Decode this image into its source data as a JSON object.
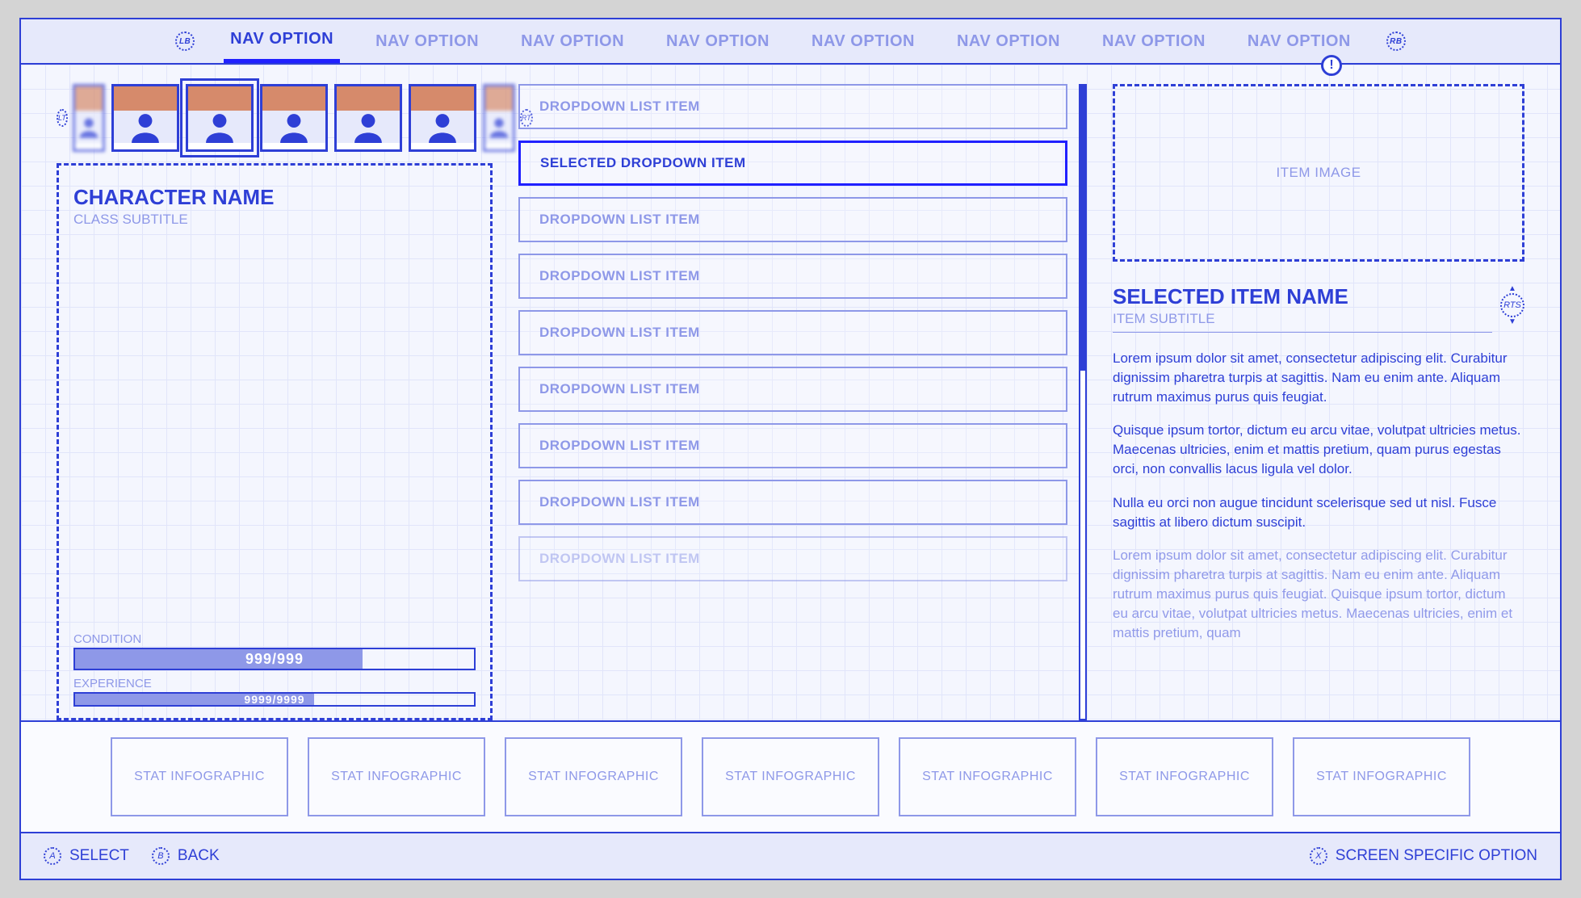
{
  "nav": {
    "bumper_left": "LB",
    "bumper_right": "RB",
    "items": [
      {
        "label": "NAV OPTION",
        "active": true
      },
      {
        "label": "NAV OPTION"
      },
      {
        "label": "NAV OPTION"
      },
      {
        "label": "NAV OPTION"
      },
      {
        "label": "NAV OPTION"
      },
      {
        "label": "NAV OPTION"
      },
      {
        "label": "NAV OPTION"
      },
      {
        "label": "NAV OPTION"
      }
    ],
    "alert_glyph": "!"
  },
  "roster": {
    "trigger_left": "LT",
    "trigger_right": "RT",
    "portraits": [
      {
        "selected": false,
        "blurred": true
      },
      {
        "selected": false
      },
      {
        "selected": true
      },
      {
        "selected": false
      },
      {
        "selected": false
      },
      {
        "selected": false
      },
      {
        "selected": false,
        "blurred": true
      }
    ]
  },
  "character": {
    "name": "CHARACTER NAME",
    "subtitle": "CLASS SUBTITLE",
    "condition": {
      "label": "CONDITION",
      "text": "999/999",
      "pct": 72
    },
    "experience": {
      "label": "EXPERIENCE",
      "text": "9999/9999",
      "pct": 60
    }
  },
  "list": {
    "items": [
      {
        "label": "DROPDOWN LIST ITEM"
      },
      {
        "label": "SELECTED DROPDOWN ITEM",
        "selected": true
      },
      {
        "label": "DROPDOWN LIST ITEM"
      },
      {
        "label": "DROPDOWN LIST ITEM"
      },
      {
        "label": "DROPDOWN LIST ITEM"
      },
      {
        "label": "DROPDOWN LIST ITEM"
      },
      {
        "label": "DROPDOWN LIST ITEM"
      },
      {
        "label": "DROPDOWN LIST ITEM"
      },
      {
        "label": "DROPDOWN LIST ITEM",
        "faded": true
      }
    ]
  },
  "detail": {
    "image_placeholder": "ITEM IMAGE",
    "title": "SELECTED ITEM NAME",
    "subtitle": "ITEM SUBTITLE",
    "rts": "RTS",
    "paragraphs": [
      "Lorem ipsum dolor sit amet, consectetur adipiscing elit. Curabitur dignissim pharetra turpis at sagittis. Nam eu enim ante. Aliquam rutrum maximus purus quis feugiat.",
      "Quisque ipsum tortor, dictum eu arcu vitae, volutpat ultricies metus. Maecenas ultricies, enim et mattis pretium, quam purus egestas orci, non convallis lacus ligula vel dolor.",
      "Nulla eu orci non augue tincidunt scelerisque sed ut nisl. Fusce sagittis at libero dictum suscipit.",
      "Lorem ipsum dolor sit amet, consectetur adipiscing elit. Curabitur dignissim pharetra turpis at sagittis. Nam eu enim ante. Aliquam rutrum maximus purus quis feugiat. Quisque ipsum tortor, dictum eu arcu vitae, volutpat ultricies metus. Maecenas ultricies, enim et mattis pretium, quam"
    ]
  },
  "stats": [
    {
      "label": "STAT INFOGRAPHIC"
    },
    {
      "label": "STAT INFOGRAPHIC"
    },
    {
      "label": "STAT INFOGRAPHIC"
    },
    {
      "label": "STAT INFOGRAPHIC"
    },
    {
      "label": "STAT INFOGRAPHIC"
    },
    {
      "label": "STAT INFOGRAPHIC"
    },
    {
      "label": "STAT INFOGRAPHIC"
    }
  ],
  "footer": {
    "select": {
      "glyph": "A",
      "label": "SELECT"
    },
    "back": {
      "glyph": "B",
      "label": "BACK"
    },
    "screen_option": {
      "glyph": "X",
      "label": "SCREEN SPECIFIC OPTION"
    }
  }
}
